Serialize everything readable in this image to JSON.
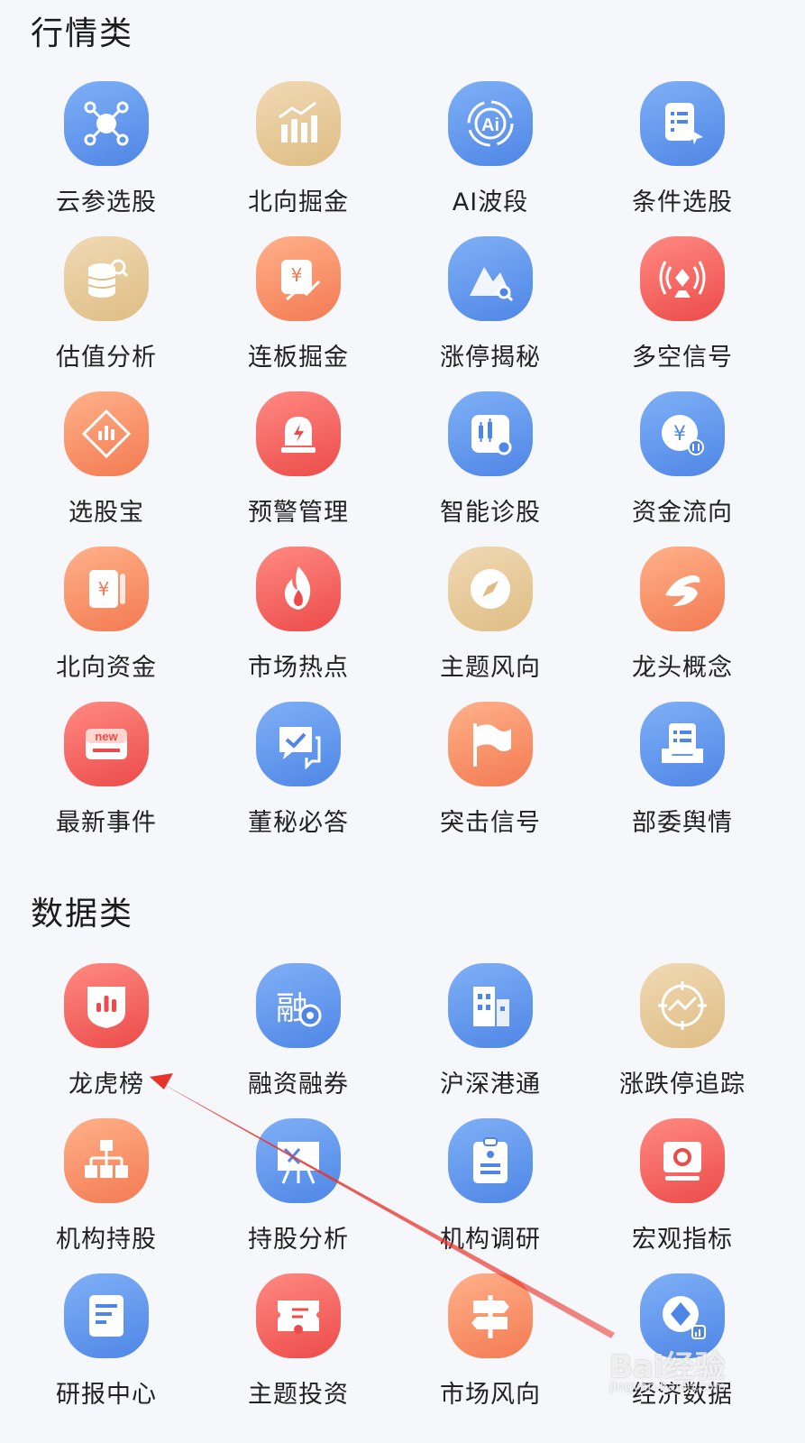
{
  "sections": [
    {
      "title": "行情类",
      "items": [
        {
          "label": "云参选股",
          "icon": "cloud-network-icon",
          "color": "blue"
        },
        {
          "label": "北向掘金",
          "icon": "bar-chart-up-icon",
          "color": "gold"
        },
        {
          "label": "AI波段",
          "icon": "ai-icon",
          "color": "blue"
        },
        {
          "label": "条件选股",
          "icon": "checklist-cursor-icon",
          "color": "blue"
        },
        {
          "label": "估值分析",
          "icon": "coins-search-icon",
          "color": "gold"
        },
        {
          "label": "连板掘金",
          "icon": "yen-chart-icon",
          "color": "orange"
        },
        {
          "label": "涨停揭秘",
          "icon": "mountain-search-icon",
          "color": "blue"
        },
        {
          "label": "多空信号",
          "icon": "signal-broadcast-icon",
          "color": "red"
        },
        {
          "label": "选股宝",
          "icon": "diamond-chart-icon",
          "color": "orange"
        },
        {
          "label": "预警管理",
          "icon": "alarm-light-icon",
          "color": "red"
        },
        {
          "label": "智能诊股",
          "icon": "candlestick-icon",
          "color": "blue"
        },
        {
          "label": "资金流向",
          "icon": "yen-flow-icon",
          "color": "blue"
        },
        {
          "label": "北向资金",
          "icon": "yen-card-icon",
          "color": "orange"
        },
        {
          "label": "市场热点",
          "icon": "flame-icon",
          "color": "red"
        },
        {
          "label": "主题风向",
          "icon": "compass-icon",
          "color": "gold"
        },
        {
          "label": "龙头概念",
          "icon": "dragon-icon",
          "color": "orange"
        },
        {
          "label": "最新事件",
          "icon": "new-badge-icon",
          "color": "red"
        },
        {
          "label": "董秘必答",
          "icon": "chat-check-icon",
          "color": "blue"
        },
        {
          "label": "突击信号",
          "icon": "flag-icon",
          "color": "orange"
        },
        {
          "label": "部委舆情",
          "icon": "document-tray-icon",
          "color": "blue"
        }
      ]
    },
    {
      "title": "数据类",
      "items": [
        {
          "label": "龙虎榜",
          "icon": "shield-chart-icon",
          "color": "red"
        },
        {
          "label": "融资融券",
          "icon": "rong-coin-icon",
          "color": "blue"
        },
        {
          "label": "沪深港通",
          "icon": "buildings-icon",
          "color": "blue"
        },
        {
          "label": "涨跌停追踪",
          "icon": "target-trend-icon",
          "color": "gold"
        },
        {
          "label": "机构持股",
          "icon": "org-chart-icon",
          "color": "orange"
        },
        {
          "label": "持股分析",
          "icon": "presentation-board-icon",
          "color": "blue"
        },
        {
          "label": "机构调研",
          "icon": "clipboard-icon",
          "color": "blue"
        },
        {
          "label": "宏观指标",
          "icon": "monitor-icon",
          "color": "red"
        },
        {
          "label": "研报中心",
          "icon": "report-icon",
          "color": "blue"
        },
        {
          "label": "主题投资",
          "icon": "ticket-pin-icon",
          "color": "red"
        },
        {
          "label": "市场风向",
          "icon": "signpost-icon",
          "color": "orange"
        },
        {
          "label": "经济数据",
          "icon": "coin-chart-icon",
          "color": "blue"
        }
      ]
    }
  ],
  "watermark": {
    "text": "Bai经验",
    "sub": "jingyan.baidu.com"
  },
  "annotation_color": "#e8332b"
}
